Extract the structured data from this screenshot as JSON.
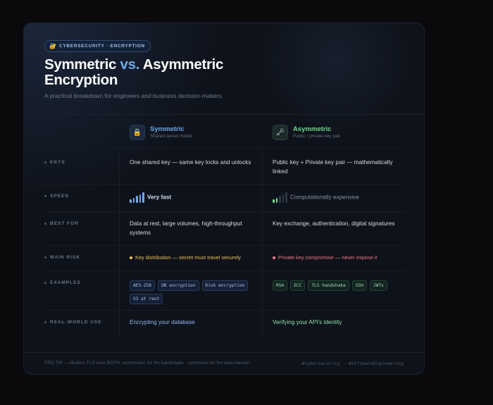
{
  "badge": {
    "icon": "lock-icon",
    "text": "CYBERSECURITY · ENCRYPTION"
  },
  "title": {
    "part1": "Symmetric ",
    "vs": "vs.",
    "part2": " Asymmetric Encryption"
  },
  "subtitle": "A practical breakdown for engineers and business decision-makers",
  "columns": {
    "symmetric": {
      "icon": "lock-icon",
      "name": "Symmetric",
      "sub": "Shared secret model",
      "color": "#6fa8e8"
    },
    "asymmetric": {
      "icon": "key-icon",
      "name": "Asymmetric",
      "sub": "Public / private key pair",
      "color": "#6fd98f"
    }
  },
  "rows": {
    "keys": {
      "label": "KEYS",
      "symmetric": "One shared key — same key locks and unlocks",
      "asymmetric": "Public key + Private key pair — mathematically linked"
    },
    "speed": {
      "label": "SPEED",
      "symmetric": "Very fast",
      "asymmetric": "Computationally expensive",
      "symmetric_level": 5,
      "asymmetric_level": 2,
      "max_level": 5
    },
    "best_for": {
      "label": "BEST FOR",
      "symmetric": "Data at rest, large volumes, high-throughput systems",
      "asymmetric": "Key exchange, authentication, digital signatures"
    },
    "main_risk": {
      "label": "MAIN RISK",
      "symmetric": "Key distribution — secret must travel securely",
      "asymmetric": "Private key compromise — never expose it",
      "symmetric_color": "#f2c25a",
      "asymmetric_color": "#f07a8a"
    },
    "examples": {
      "label": "EXAMPLES",
      "symmetric": [
        "AES-256",
        "DB encryption",
        "Disk encryption",
        "S3 at rest"
      ],
      "asymmetric": [
        "RSA",
        "ECC",
        "TLS handshake",
        "SSH",
        "JWTs"
      ]
    },
    "real_world": {
      "label": "REAL-WORLD USE",
      "symmetric": "Encrypting your database",
      "asymmetric": "Verifying your API's identity"
    }
  },
  "footer": {
    "tip": "PRO TIP — Modern TLS uses BOTH: asymmetric for the handshake · symmetric for the data transfer",
    "tags": "#Cybersecurity · #SoftwareEngineering"
  }
}
